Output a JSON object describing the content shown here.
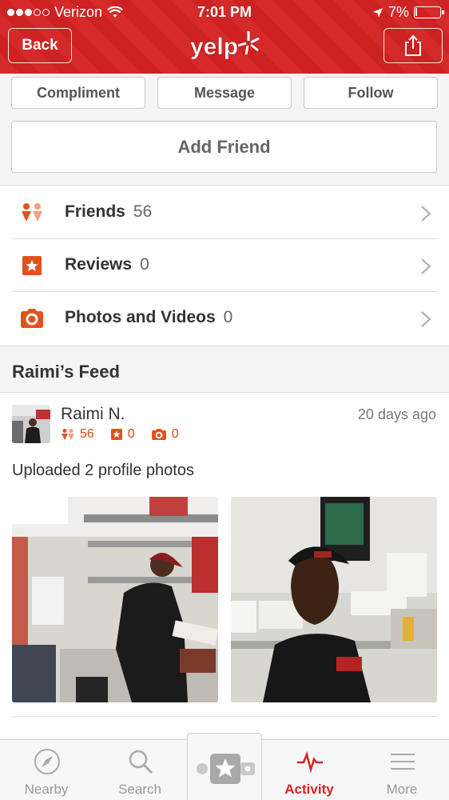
{
  "status_bar": {
    "carrier": "Verizon",
    "time": "7:01 PM",
    "battery": "7%",
    "battery_level": 0.07
  },
  "nav": {
    "back_label": "Back",
    "logo_text": "yelp"
  },
  "actions": {
    "compliment": "Compliment",
    "message": "Message",
    "follow": "Follow",
    "add_friend": "Add Friend"
  },
  "stats": [
    {
      "label": "Friends",
      "count": "56",
      "icon": "friends-icon"
    },
    {
      "label": "Reviews",
      "count": "0",
      "icon": "star-box-icon"
    },
    {
      "label": "Photos and Videos",
      "count": "0",
      "icon": "camera-icon"
    }
  ],
  "feed": {
    "title": "Raimi’s Feed",
    "item": {
      "user_name": "Raimi N.",
      "friends": "56",
      "reviews": "0",
      "photos": "0",
      "time_ago": "20 days ago",
      "text": "Uploaded 2 profile photos"
    }
  },
  "tabs": [
    {
      "label": "Nearby",
      "icon": "compass-icon"
    },
    {
      "label": "Search",
      "icon": "search-icon"
    },
    {
      "label": "",
      "icon": "check-in-icon"
    },
    {
      "label": "Activity",
      "icon": "activity-icon"
    },
    {
      "label": "More",
      "icon": "menu-icon"
    }
  ],
  "colors": {
    "brand": "#d32323",
    "accent": "#e0531c"
  }
}
